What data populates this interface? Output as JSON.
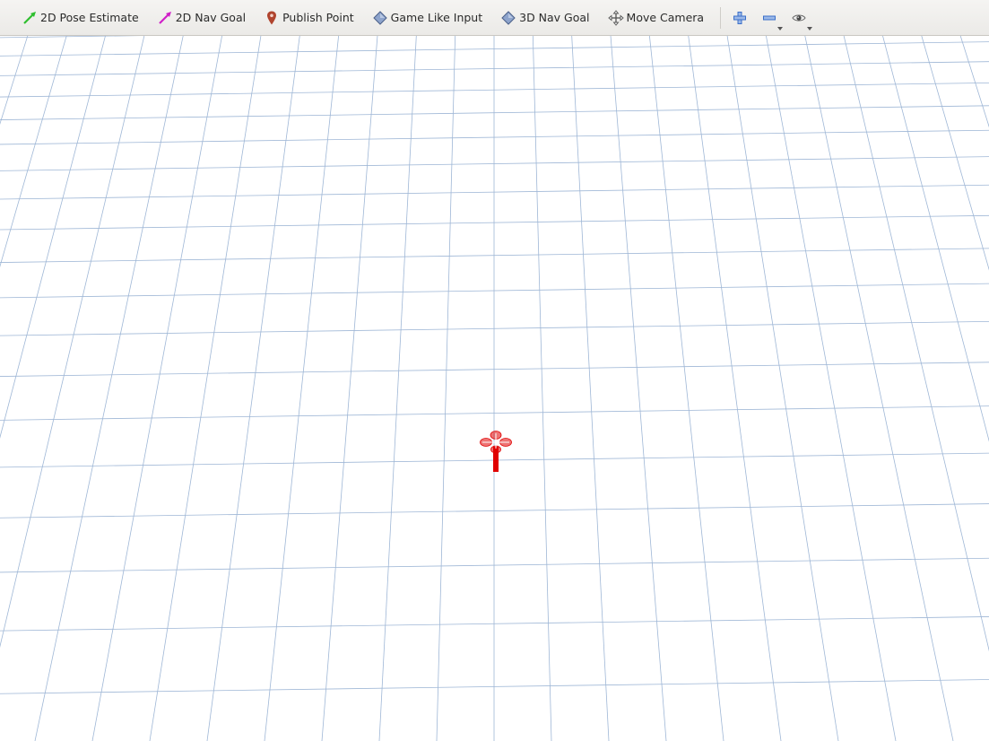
{
  "toolbar": {
    "tools": [
      {
        "label": "2D Pose Estimate",
        "icon": "green-arrow-icon",
        "color": "#2fbf2f"
      },
      {
        "label": "2D Nav Goal",
        "icon": "magenta-arrow-icon",
        "color": "#d020c8"
      },
      {
        "label": "Publish Point",
        "icon": "map-pin-icon",
        "color": "#b0442e"
      },
      {
        "label": "Game Like Input",
        "icon": "diamond-icon",
        "color": "#6d86b3"
      },
      {
        "label": "3D Nav Goal",
        "icon": "diamond-icon",
        "color": "#6d86b3"
      },
      {
        "label": "Move Camera",
        "icon": "move-cross-icon",
        "color": "#555555"
      }
    ],
    "actions": [
      {
        "name": "add-tool-button",
        "icon": "plus-icon",
        "color": "#3b6fc9"
      },
      {
        "name": "remove-tool-button",
        "icon": "minus-icon",
        "color": "#3b6fc9"
      },
      {
        "name": "view-options-button",
        "icon": "eye-icon",
        "color": "#555555"
      }
    ]
  },
  "viewport": {
    "background": "#ffffff",
    "grid_color": "#9fb7d6",
    "robot_color": "#e00000"
  }
}
